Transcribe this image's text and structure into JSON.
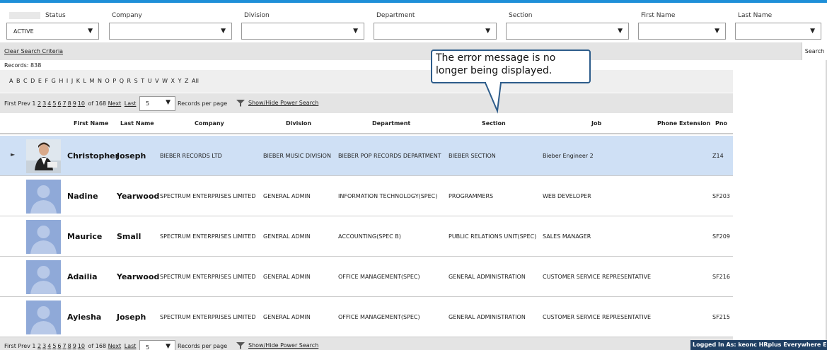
{
  "filters": [
    {
      "label": "Status",
      "value": "ACTIVE"
    },
    {
      "label": "Company",
      "value": ""
    },
    {
      "label": "Division",
      "value": ""
    },
    {
      "label": "Department",
      "value": ""
    },
    {
      "label": "Section",
      "value": ""
    },
    {
      "label": "First Name",
      "value": ""
    },
    {
      "label": "Last Name",
      "value": ""
    }
  ],
  "clear_search": "Clear Search Criteria",
  "search_button": "Search",
  "records_text": "Records:  838",
  "alphabet": "A B C D E F G H I J K L M N O P Q R S T U V W X Y Z All",
  "pager": {
    "first": "First",
    "prev": "Prev",
    "current_page": "1",
    "pages": [
      "2",
      "3",
      "4",
      "5",
      "6",
      "7",
      "8",
      "9",
      "10"
    ],
    "of_text": "of 168",
    "next": "Next",
    "last": "Last",
    "per_page_value": "5",
    "records_per_page": "Records per page",
    "power_search": "Show/Hide Power Search"
  },
  "columns": [
    "First Name",
    "Last Name",
    "Company",
    "Division",
    "Department",
    "Section",
    "Job",
    "Phone Extension",
    "Pno"
  ],
  "rows": [
    {
      "first": "Christopher",
      "last": "Joseph",
      "company": "BIEBER RECORDS LTD",
      "division": "BIEBER MUSIC DIVISION",
      "department": "BIEBER POP RECORDS DEPARTMENT",
      "section": "BIEBER SECTION",
      "job": "Bieber Engineer 2",
      "ext": "",
      "pno": "Z14"
    },
    {
      "first": "Nadine",
      "last": "Yearwood",
      "company": "SPECTRUM ENTERPRISES LIMITED",
      "division": "GENERAL ADMIN",
      "department": "INFORMATION TECHNOLOGY(SPEC)",
      "section": "PROGRAMMERS",
      "job": "WEB DEVELOPER",
      "ext": "",
      "pno": "SF203"
    },
    {
      "first": "Maurice",
      "last": "Small",
      "company": "SPECTRUM ENTERPRISES LIMITED",
      "division": "GENERAL ADMIN",
      "department": "ACCOUNTING(SPEC B)",
      "section": "PUBLIC RELATIONS UNIT(SPEC)",
      "job": "SALES MANAGER",
      "ext": "",
      "pno": "SF209"
    },
    {
      "first": "Adailia",
      "last": "Yearwood",
      "company": "SPECTRUM ENTERPRISES LIMITED",
      "division": "GENERAL ADMIN",
      "department": "OFFICE MANAGEMENT(SPEC)",
      "section": "GENERAL ADMINISTRATION",
      "job": "CUSTOMER SERVICE REPRESENTATIVE",
      "ext": "",
      "pno": "SF216"
    },
    {
      "first": "Ayiesha",
      "last": "Joseph",
      "company": "SPECTRUM ENTERPRISES LIMITED",
      "division": "GENERAL ADMIN",
      "department": "OFFICE MANAGEMENT(SPEC)",
      "section": "GENERAL ADMINISTRATION",
      "job": "CUSTOMER SERVICE REPRESENTATIVE",
      "ext": "",
      "pno": "SF215"
    }
  ],
  "callout_text": "The error message is no longer being displayed.",
  "status_bar": "Logged In As: keonc HRplus Everywhere Enterp",
  "colors": {
    "accent": "#1e8fd8",
    "selected_row": "#cfe0f5",
    "status_bar": "#1f3f63",
    "avatar": "#8fa9d8"
  }
}
